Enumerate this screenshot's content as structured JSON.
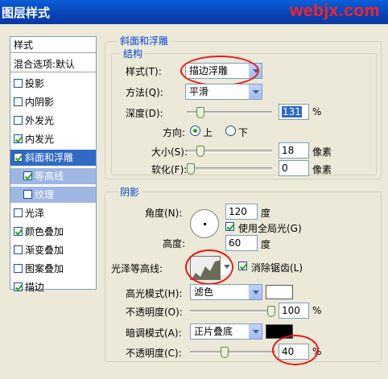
{
  "window": {
    "title": "图层样式",
    "watermark": "webjx.com"
  },
  "style_list": {
    "header": "样式",
    "blend_options": "混合选项:默认",
    "items": [
      {
        "label": "投影",
        "checked": false
      },
      {
        "label": "内阴影",
        "checked": false
      },
      {
        "label": "外发光",
        "checked": false
      },
      {
        "label": "内发光",
        "checked": true
      },
      {
        "label": "斜面和浮雕",
        "checked": true,
        "selected": true
      },
      {
        "label": "等高线",
        "checked": true,
        "sub": true
      },
      {
        "label": "纹理",
        "checked": false,
        "sub": true
      },
      {
        "label": "光泽",
        "checked": false
      },
      {
        "label": "颜色叠加",
        "checked": true
      },
      {
        "label": "渐变叠加",
        "checked": false
      },
      {
        "label": "图案叠加",
        "checked": false
      },
      {
        "label": "描边",
        "checked": true
      }
    ]
  },
  "bevel": {
    "group_title": "斜面和浮雕",
    "structure_title": "结构",
    "style_label": "样式(T):",
    "style_value": "描边浮雕",
    "technique_label": "方法(Q):",
    "technique_value": "平滑",
    "depth_label": "深度(D):",
    "depth_value": "131",
    "depth_unit": "%",
    "depth_slider": 0.13,
    "direction_label": "方向:",
    "direction_up": "上",
    "direction_down": "下",
    "size_label": "大小(S):",
    "size_value": "18",
    "size_unit": "像素",
    "size_slider": 0.12,
    "soften_label": "软化(F):",
    "soften_value": "0",
    "soften_unit": "像素",
    "soften_slider": 0.0
  },
  "shading": {
    "title": "阴影",
    "angle_label": "角度(N):",
    "angle_value": "120",
    "angle_unit": "度",
    "global_light_label": "使用全局光(G)",
    "altitude_label": "高度:",
    "altitude_value": "60",
    "altitude_unit": "度",
    "gloss_contour_label": "光泽等高线:",
    "antialias_label": "消除锯齿(L)",
    "highlight_mode_label": "高光模式(H):",
    "highlight_mode_value": "滤色",
    "highlight_color": "#ffffff",
    "highlight_opacity_label": "不透明度(O):",
    "highlight_opacity_value": "100",
    "highlight_opacity_slider": 1.0,
    "shadow_mode_label": "暗调模式(A):",
    "shadow_mode_value": "正片叠底",
    "shadow_color": "#000000",
    "shadow_opacity_label": "不透明度(C):",
    "shadow_opacity_value": "40",
    "shadow_opacity_slider": 0.4,
    "percent": "%"
  }
}
